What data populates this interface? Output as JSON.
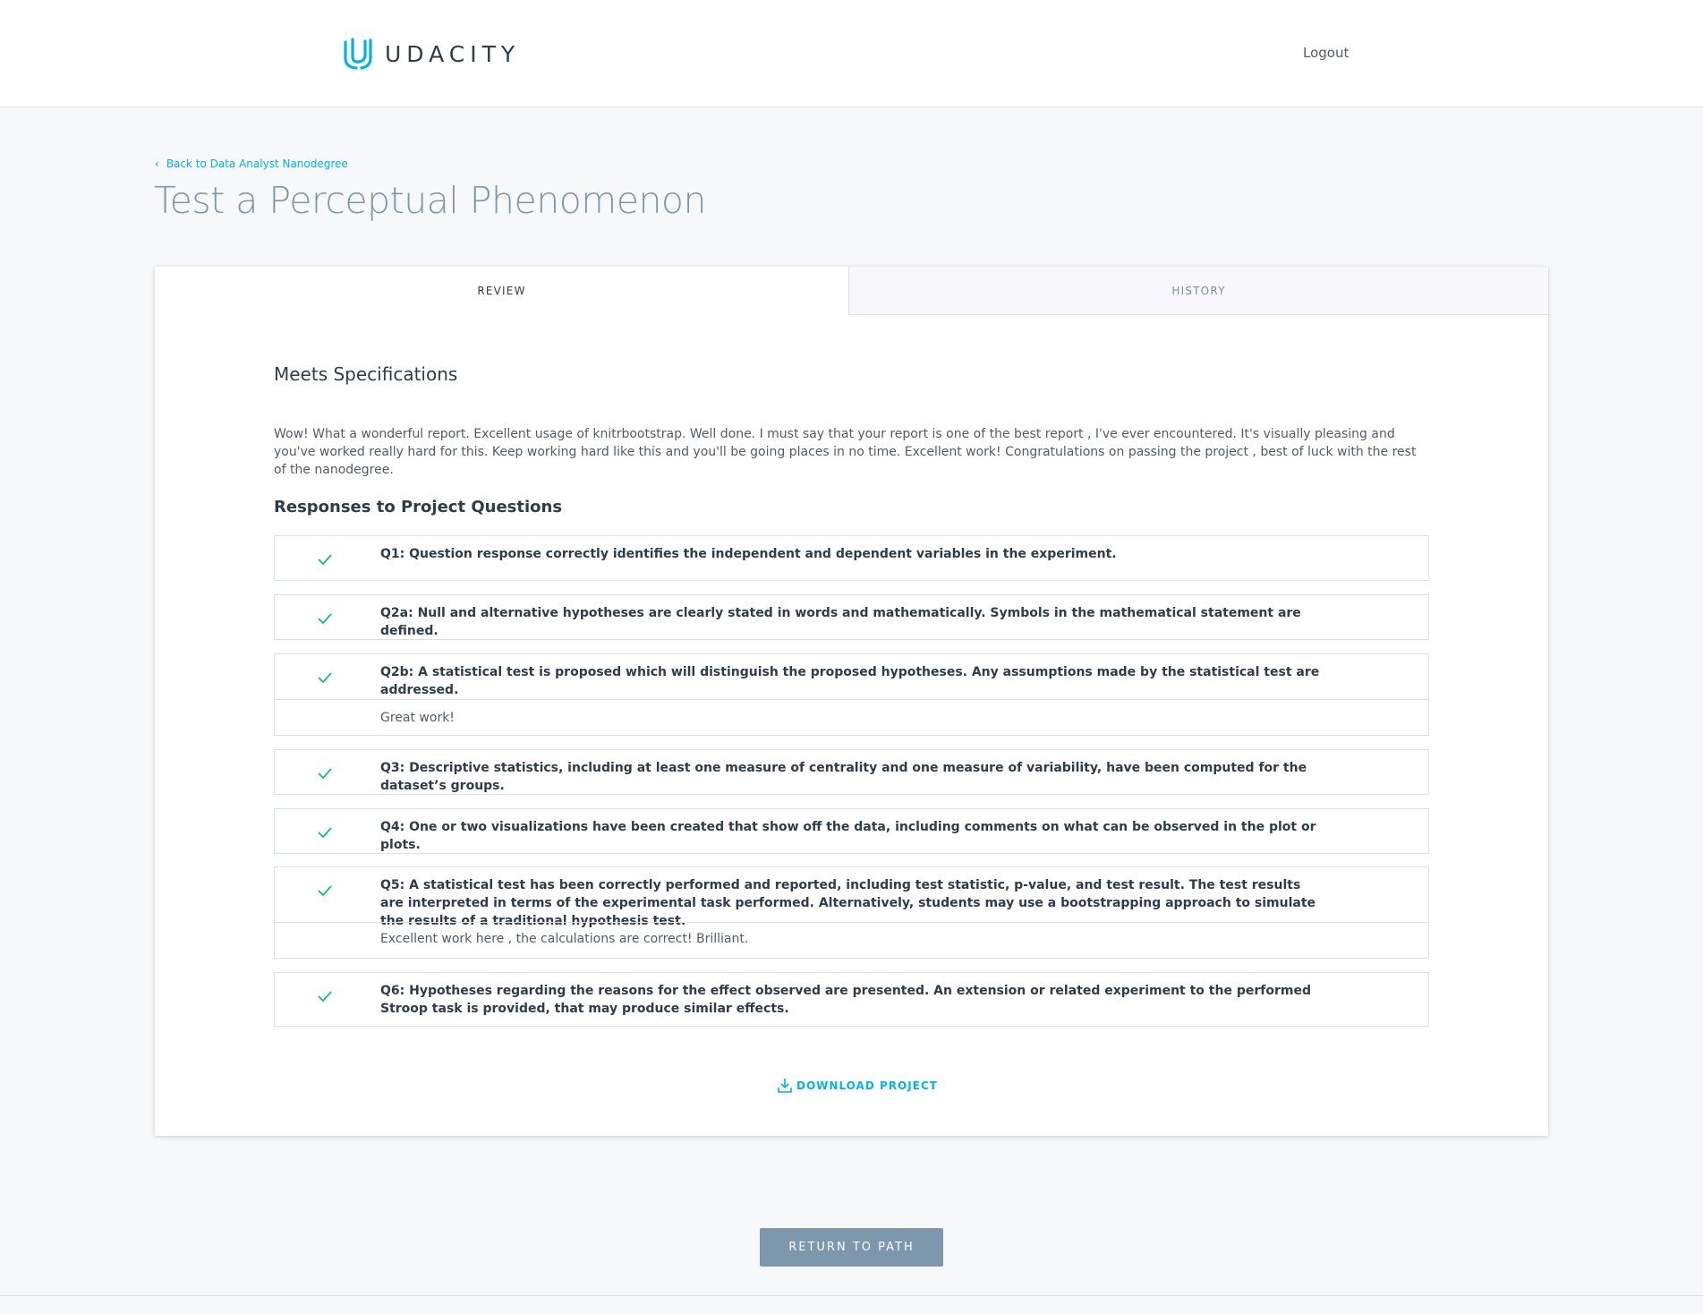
{
  "header": {
    "logo_text": "UDACITY",
    "logout_label": "Logout"
  },
  "breadcrumb": {
    "back_label": "Back to Data Analyst Nanodegree"
  },
  "page": {
    "title": "Test a Perceptual Phenomenon"
  },
  "tabs": [
    {
      "label": "REVIEW",
      "active": true
    },
    {
      "label": "HISTORY",
      "active": false
    }
  ],
  "review": {
    "verdict": "Meets Specifications",
    "summary": "Wow! What a wonderful report. Excellent usage of knitrbootstrap. Well done. I must say that your report is one of the best report , I've ever encountered. It's visually pleasing and you've worked really hard for this. Keep working hard like this and you'll be going places in no time. Excellent work! Congratulations on passing the project , best of luck with the rest of the nanodegree.",
    "section_title": "Responses to Project Questions",
    "criteria": [
      {
        "text": "Q1: Question response correctly identifies the independent and dependent variables in the experiment.",
        "comment": ""
      },
      {
        "text": "Q2a: Null and alternative hypotheses are clearly stated in words and mathematically. Symbols in the mathematical statement are defined.",
        "comment": ""
      },
      {
        "text": "Q2b: A statistical test is proposed which will distinguish the proposed hypotheses. Any assumptions made by the statistical test are addressed.",
        "comment": "Great work!"
      },
      {
        "text": "Q3: Descriptive statistics, including at least one measure of centrality and one measure of variability, have been computed for the dataset’s groups.",
        "comment": ""
      },
      {
        "text": "Q4: One or two visualizations have been created that show off the data, including comments on what can be observed in the plot or plots.",
        "comment": ""
      },
      {
        "text": "Q5: A statistical test has been correctly performed and reported, including test statistic, p-value, and test result. The test results are interpreted in terms of the experimental task performed. Alternatively, students may use a bootstrapping approach to simulate the results of a traditional hypothesis test.",
        "comment": "Excellent work here , the calculations are correct! Brilliant."
      },
      {
        "text": "Q6: Hypotheses regarding the reasons for the effect observed are presented. An extension or related experiment to the performed Stroop task is provided, that may produce similar effects.",
        "comment": ""
      }
    ],
    "download_label": "DOWNLOAD PROJECT"
  },
  "footer": {
    "return_label": "RETURN TO PATH"
  },
  "colors": {
    "accent": "#02b3e4",
    "check": "#15c26b",
    "button": "#7d97ad",
    "title": "#7d97ad"
  }
}
